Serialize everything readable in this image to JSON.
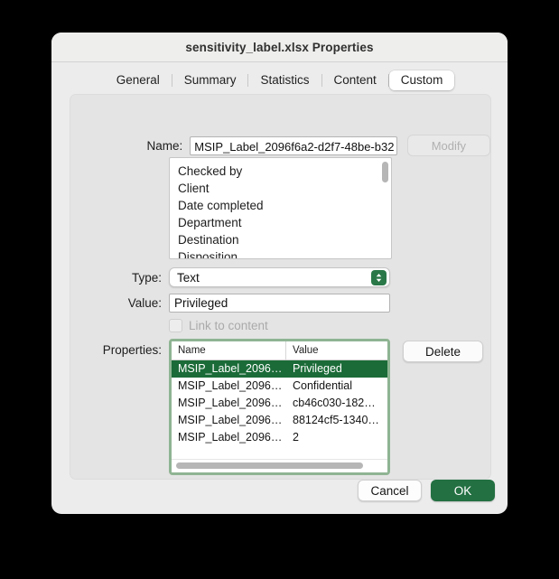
{
  "window": {
    "title": "sensitivity_label.xlsx Properties"
  },
  "tabs": [
    {
      "label": "General",
      "selected": false
    },
    {
      "label": "Summary",
      "selected": false
    },
    {
      "label": "Statistics",
      "selected": false
    },
    {
      "label": "Content",
      "selected": false
    },
    {
      "label": "Custom",
      "selected": true
    }
  ],
  "fields": {
    "name_label": "Name:",
    "name_value": "MSIP_Label_2096f6a2-d2f7-48be-b32",
    "modify_label": "Modify",
    "type_label": "Type:",
    "type_value": "Text",
    "value_label": "Value:",
    "value_value": "Privileged",
    "link_to_content_label": "Link to content",
    "properties_label": "Properties:",
    "delete_label": "Delete"
  },
  "name_suggestions": [
    "Checked by",
    "Client",
    "Date completed",
    "Department",
    "Destination",
    "Disposition"
  ],
  "properties_table": {
    "columns": [
      "Name",
      "Value"
    ],
    "rows": [
      {
        "name": "MSIP_Label_2096…",
        "value": "Privileged",
        "selected": true
      },
      {
        "name": "MSIP_Label_2096…",
        "value": "Confidential",
        "selected": false
      },
      {
        "name": "MSIP_Label_2096…",
        "value": "cb46c030-182…",
        "selected": false
      },
      {
        "name": "MSIP_Label_2096…",
        "value": "88124cf5-1340…",
        "selected": false
      },
      {
        "name": "MSIP_Label_2096…",
        "value": "2",
        "selected": false
      }
    ]
  },
  "footer": {
    "cancel_label": "Cancel",
    "ok_label": "OK"
  },
  "colors": {
    "accent_green": "#237042",
    "selection_green": "#1b6b38",
    "focus_ring_green": "#8fb493",
    "dialog_bg": "#ececec",
    "panel_bg": "#e4e4e4"
  }
}
